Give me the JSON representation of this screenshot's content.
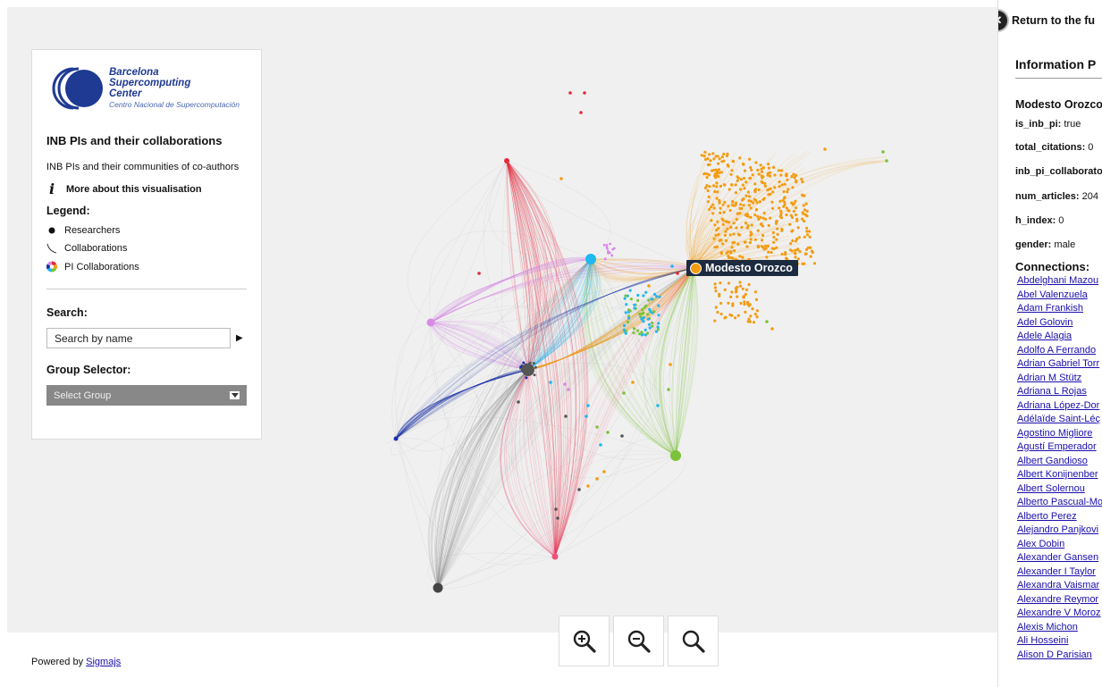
{
  "logo": {
    "badge": "BSC",
    "line1": "Barcelona",
    "line2": "Supercomputing",
    "line3": "Center",
    "line4": "Centro Nacional de Supercomputación"
  },
  "panel": {
    "title": "INB PIs and their collaborations",
    "description": "INB PIs and their communities of co-authors",
    "more_link": "More about this visualisation",
    "legend_title": "Legend:",
    "legend": [
      {
        "label": "Researchers",
        "icon": "dot-icon"
      },
      {
        "label": "Collaborations",
        "icon": "curve-icon"
      },
      {
        "label": "PI Collaborations",
        "icon": "color-wheel-icon"
      }
    ],
    "search_title": "Search:",
    "search_placeholder": "Search by name",
    "group_title": "Group Selector:",
    "group_value": "Select Group"
  },
  "graph": {
    "selected_label": "Modesto Orozco",
    "selected_color": "#f39c12"
  },
  "footer": {
    "powered_prefix": "Powered by ",
    "powered_link": "Sigmajs"
  },
  "info": {
    "return_label": "Return to the fu",
    "title": "Information P",
    "name": "Modesto Orozco",
    "attributes": [
      {
        "key": "is_inb_pi:",
        "value": " true"
      },
      {
        "key": "total_citations:",
        "value": " 0"
      },
      {
        "key": "inb_pi_collaborato",
        "value": ""
      },
      {
        "key": "num_articles:",
        "value": " 204"
      },
      {
        "key": "h_index:",
        "value": " 0"
      },
      {
        "key": "gender:",
        "value": " male"
      }
    ],
    "connections_title": "Connections:",
    "connections": [
      "Abdelghani Mazou",
      "Abel Valenzuela",
      "Adam Frankish",
      "Adel Golovin",
      "Adele Alagia",
      "Adolfo A Ferrando",
      "Adrian Gabriel Torr",
      "Adrian M Stütz",
      "Adriana L Rojas",
      "Adriana López-Dor",
      "Adélaïde Saint-Léç",
      "Agostino Migliore",
      "Agustí Emperador",
      "Albert Gandioso",
      "Albert Konijnenber",
      "Albert Solernou",
      "Alberto Pascual-Mo",
      "Alberto Perez",
      "Alejandro Panjkovi",
      "Alex Dobin",
      "Alexander Gansen",
      "Alexander I Taylor",
      "Alexandra Vaismar",
      "Alexandre Reymor",
      "Alexandre V Moroz",
      "Alexis Michon",
      "Ali Hosseini",
      "Alison D Parisian"
    ]
  },
  "colors": {
    "orange": "#f39c12",
    "cyan": "#1fb8f0",
    "violet": "#d98ae6",
    "green": "#7cc23a",
    "navy": "#1a2fa8",
    "red": "#e5283a",
    "pink": "#f0507a",
    "dark": "#444444"
  }
}
